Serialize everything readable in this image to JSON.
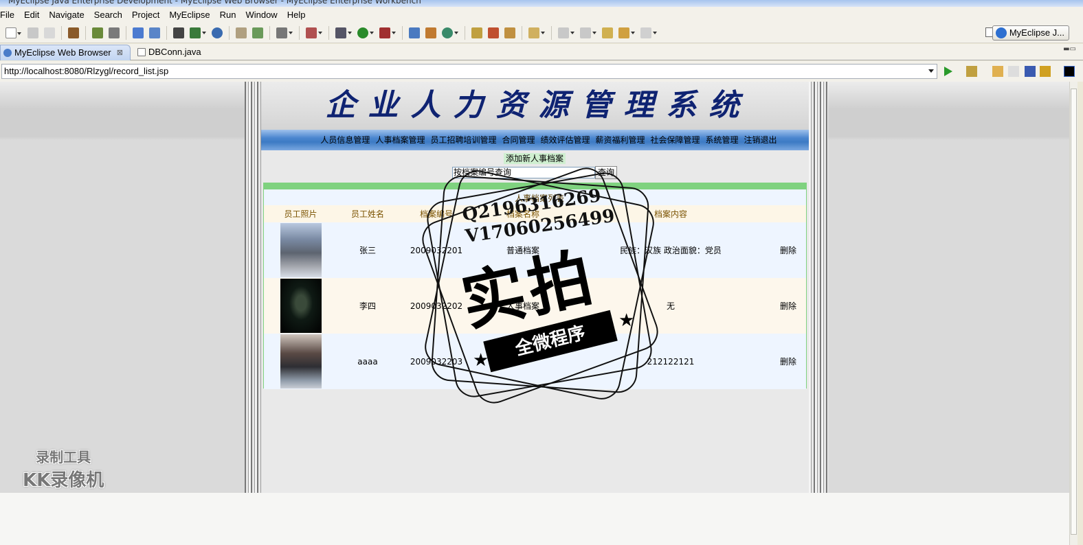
{
  "window": {
    "title": "MyEclipse Java Enterprise Development - MyEclipse Web Browser - MyEclipse Enterprise Workbench"
  },
  "menu": [
    "File",
    "Edit",
    "Navigate",
    "Search",
    "Project",
    "MyEclipse",
    "Run",
    "Window",
    "Help"
  ],
  "perspective": {
    "label": "MyEclipse J..."
  },
  "tabs": [
    {
      "label": "MyEclipse Web Browser",
      "close": "⊠"
    },
    {
      "label": "DBConn.java"
    }
  ],
  "address": {
    "url": "http://localhost:8080/Rlzygl/record_list.jsp"
  },
  "site": {
    "title": "企业人力资源管理系统",
    "nav": [
      "人员信息管理",
      "人事档案管理",
      "员工招聘培训管理",
      "合同管理",
      "绩效评估管理",
      "薪资福利管理",
      "社会保障管理",
      "系统管理",
      "注销退出"
    ],
    "add_link": "添加新人事档案",
    "search_placeholder": "按档案编号查询",
    "search_button": "查询"
  },
  "table": {
    "caption": "人事档案列表",
    "headers": [
      "员工照片",
      "员工姓名",
      "档案编号",
      "档案名称",
      "档案内容",
      ""
    ],
    "rows": [
      {
        "name": "张三",
        "id": "2009032201",
        "type": "普通档案",
        "content": "民族：汉族 政治面貌：党员",
        "action": "删除"
      },
      {
        "name": "李四",
        "id": "2009032202",
        "type": "人事档案",
        "content": "无",
        "action": "删除"
      },
      {
        "name": "aaaa",
        "id": "2009032203",
        "type": "",
        "content": "212122121",
        "action": "删除"
      }
    ]
  },
  "watermark": {
    "line1": "Q2196316269",
    "line2": "V17060256499",
    "big": "实拍",
    "ribbon": "全微程序"
  },
  "recorder": {
    "line1": "录制工具",
    "line2": "KK录像机"
  },
  "colors": {
    "title_blue": "#0f2372",
    "nav_blue": "#3c7ac4",
    "table_green": "#7fd27f"
  }
}
